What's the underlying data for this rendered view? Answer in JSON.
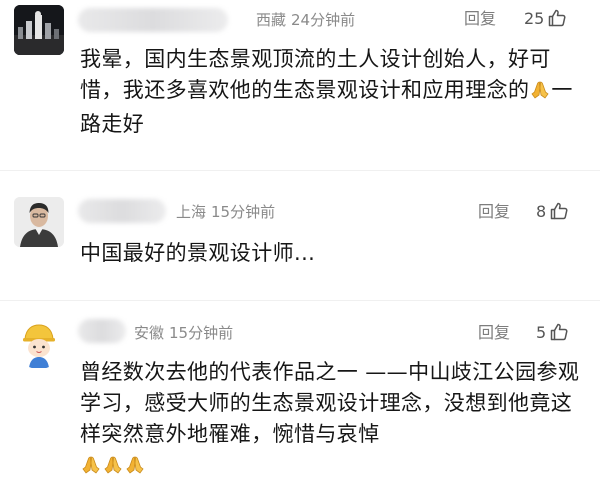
{
  "comments": [
    {
      "location": "西藏",
      "time": "24分钟前",
      "reply_label": "回复",
      "likes": "25",
      "text_parts": [
        "我晕，国内生态景观顶流的土人设计创始人，好可惜，我还多喜欢他的生态景观设计和应用理念的",
        "一路走好"
      ],
      "emoji_count": 1
    },
    {
      "location": "上海",
      "time": "15分钟前",
      "reply_label": "回复",
      "likes": "8",
      "text_parts": [
        "中国最好的景观设计师..."
      ],
      "emoji_count": 0
    },
    {
      "location": "安徽",
      "time": "15分钟前",
      "reply_label": "回复",
      "likes": "5",
      "text_parts": [
        "曾经数次去他的代表作品之一 ——中山歧江公园参观学习，感受大师的生态景观设计理念，没想到他竟这样突然意外地罹难，惋惜与哀悼"
      ],
      "emoji_count": 3
    }
  ],
  "icons": {
    "like": "thumbs-up-icon",
    "emoji": "folded-hands-emoji"
  },
  "colors": {
    "meta": "#8a8a8a",
    "text": "#161616",
    "emoji": "#f2b233"
  }
}
